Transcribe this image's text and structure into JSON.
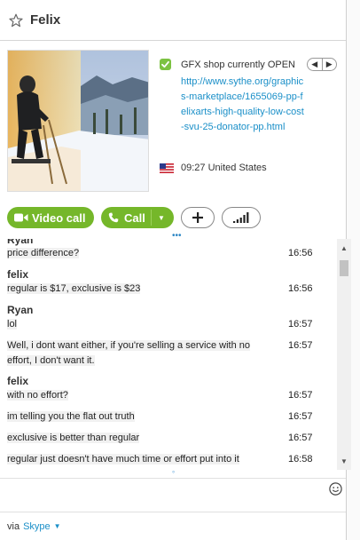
{
  "contact": {
    "name": "Felix"
  },
  "profile": {
    "mood_status": "GFX shop currently OPEN",
    "mood_link": "http://www.sythe.org/graphics-marketplace/1655069-pp-felixarts-high-quality-low-cost-svu-25-donator-pp.html",
    "local_time": "09:27",
    "country": "United States"
  },
  "actions": {
    "video_call_label": "Video call",
    "call_label": "Call"
  },
  "conversation": {
    "top_sender": "Ryan",
    "messages": [
      {
        "sender": "",
        "text": "price difference?",
        "time": "16:56"
      },
      {
        "sender": "felix",
        "text": "regular is $17, exclusive is $23",
        "time": "16:56"
      },
      {
        "sender": "Ryan",
        "text": "lol",
        "time": "16:57"
      },
      {
        "sender": "",
        "text": "Well, i dont want either, if you're selling a service with no",
        "text2": "effort, I don't want it.",
        "time": "16:57"
      },
      {
        "sender": "felix",
        "text": "with no effort?",
        "time": "16:57"
      },
      {
        "sender": "",
        "text": "im telling you the flat out truth",
        "time": "16:57"
      },
      {
        "sender": "",
        "text": "exclusive is better than regular",
        "time": "16:57"
      },
      {
        "sender": "",
        "text": "regular just doesn't have much time or effort put into it",
        "time": "16:58"
      }
    ]
  },
  "footer": {
    "via": "via",
    "service": "Skype"
  },
  "icons": {
    "favorite": "star-outline-icon",
    "mood": "green-check-badge-icon",
    "flag": "us-flag-icon",
    "video": "video-camera-icon",
    "phone": "phone-icon",
    "add": "plus-icon",
    "signal": "call-quality-bars-icon",
    "emoticon": "smiley-icon"
  },
  "colors": {
    "accent_green": "#75b72a",
    "link_blue": "#1a8fc8"
  }
}
